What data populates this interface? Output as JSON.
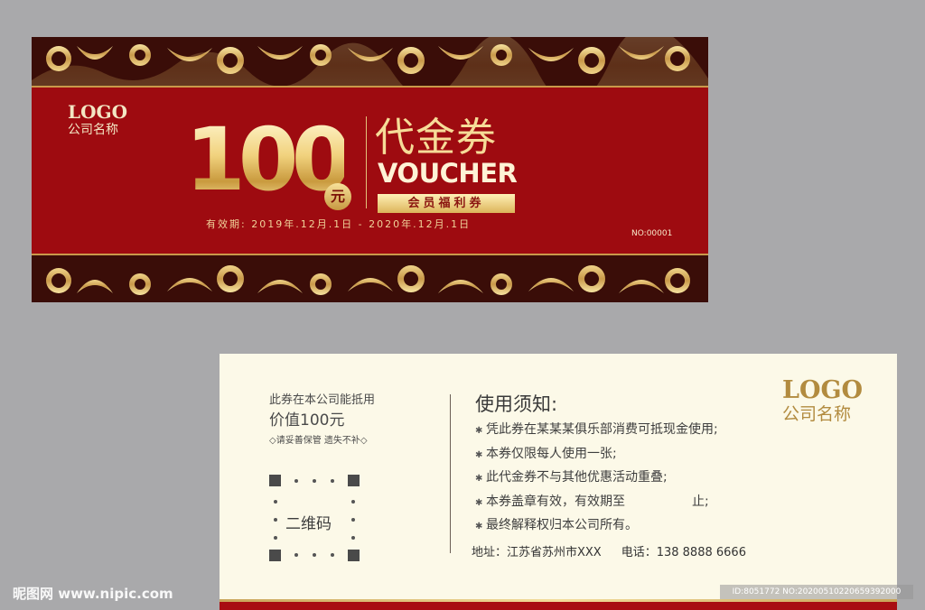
{
  "front": {
    "logo": "LOGO",
    "company": "公司名称",
    "amount": "100",
    "yuan": "元",
    "title_cn": "代金券",
    "title_en": "VOUCHER",
    "member_tag": "会员福利券",
    "validity": "有效期: 2019年.12月.1日 - 2020年.12月.1日",
    "serial": "NO:00001"
  },
  "back": {
    "usable_line": "此券在本公司能抵用",
    "value_line": "价值100元",
    "keep_line": "◇请妥善保管 遗失不补◇",
    "qr_label": "二维码",
    "notice_title": "使用须知:",
    "notice_items": [
      "凭此券在某某某俱乐部消费可抵现金使用;",
      "本券仅限每人使用一张;",
      "此代金券不与其他优惠活动重叠;",
      "本券盖章有效，有效期至",
      "最终解释权归本公司所有。"
    ],
    "notice_item_4_suffix": "止;",
    "address": "地址：江苏省苏州市XXX",
    "phone": "电话：138 8888 6666",
    "logo": "LOGO",
    "company": "公司名称"
  },
  "watermark": {
    "site": "昵图网 www.nipic.com",
    "id": "ID:8051772 NO:20200510220659392000"
  },
  "colors": {
    "front_red": "#9e0b10",
    "border_dark": "#3a0d08",
    "gold": "#e8c777",
    "back_cream": "#fcf9e8",
    "back_gold_text": "#b28b3f"
  }
}
